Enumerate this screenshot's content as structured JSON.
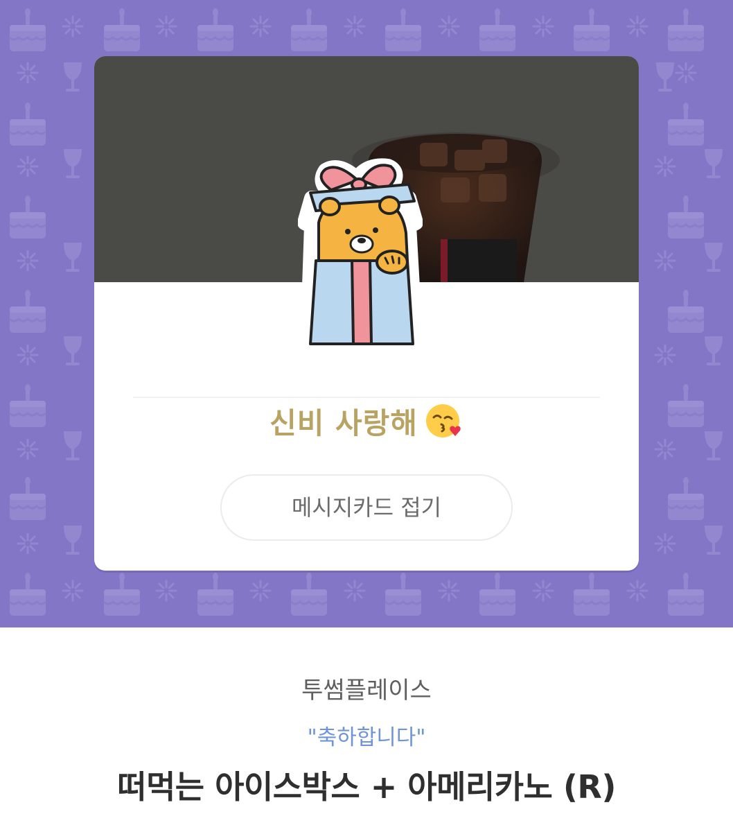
{
  "background": {
    "color": "#8476c7",
    "pattern_icons": [
      "cake-icon",
      "sparkle-icon",
      "wine-glass-icon"
    ]
  },
  "card": {
    "photo_icon": "iced-americano-photo",
    "sticker_icon": "bear-in-gift-box-sticker",
    "message": "신비 사랑해",
    "message_emoji": "kissing-face-with-heart-icon",
    "message_color": "#b8a363",
    "fold_button_label": "메시지카드 접기"
  },
  "gift": {
    "brand": "투썸플레이스",
    "subtitle": "\"축하합니다\"",
    "product_name": "떠먹는 아이스박스 + 아메리카노 (R)"
  }
}
